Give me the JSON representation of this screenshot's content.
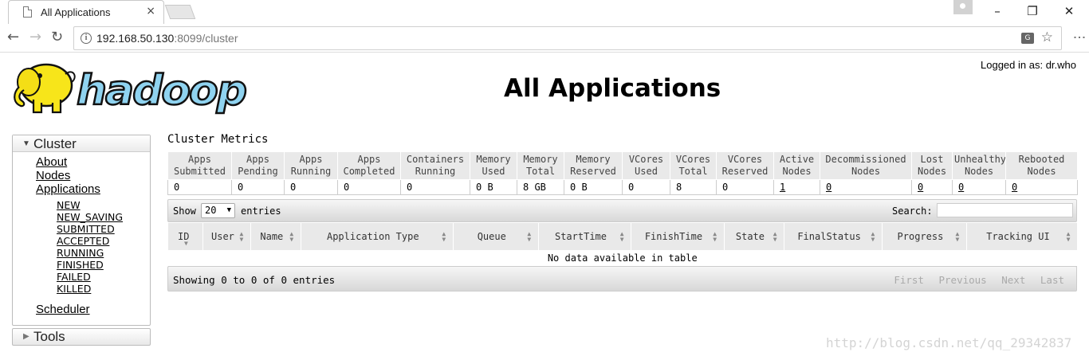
{
  "browser": {
    "tab_title": "All Applications",
    "tab_close": "×",
    "window_controls": {
      "minimize": "–",
      "maximize": "❐",
      "close": "✕"
    },
    "nav": {
      "back": "←",
      "forward": "→",
      "reload": "↻"
    },
    "url_host": "192.168.50.130",
    "url_rest": ":8099/cluster",
    "info_icon": "i",
    "translate_icon": "G",
    "bookmark_icon": "☆",
    "menu_icon": "⋮"
  },
  "header": {
    "logo_text": "hadoop",
    "logged_in": "Logged in as: dr.who",
    "title": "All Applications"
  },
  "sidebar": {
    "cluster_title": "Cluster",
    "links": [
      "About",
      "Nodes",
      "Applications"
    ],
    "app_states": [
      "NEW",
      "NEW_SAVING",
      "SUBMITTED",
      "ACCEPTED",
      "RUNNING",
      "FINISHED",
      "FAILED",
      "KILLED"
    ],
    "scheduler": "Scheduler",
    "tools_title": "Tools"
  },
  "metrics": {
    "title": "Cluster Metrics",
    "headers": [
      [
        "Apps",
        "Submitted"
      ],
      [
        "Apps",
        "Pending"
      ],
      [
        "Apps",
        "Running"
      ],
      [
        "Apps",
        "Completed"
      ],
      [
        "Containers",
        "Running"
      ],
      [
        "Memory",
        "Used"
      ],
      [
        "Memory",
        "Total"
      ],
      [
        "Memory",
        "Reserved"
      ],
      [
        "VCores",
        "Used"
      ],
      [
        "VCores",
        "Total"
      ],
      [
        "VCores",
        "Reserved"
      ],
      [
        "Active",
        "Nodes"
      ],
      [
        "Decommissioned",
        "Nodes"
      ],
      [
        "Lost",
        "Nodes"
      ],
      [
        "Unhealthy",
        "Nodes"
      ],
      [
        "Rebooted",
        "Nodes"
      ]
    ],
    "values": [
      "0",
      "0",
      "0",
      "0",
      "0",
      "0 B",
      "8 GB",
      "0 B",
      "0",
      "8",
      "0",
      "1",
      "0",
      "0",
      "0",
      "0"
    ]
  },
  "apps_table": {
    "show_label": "Show",
    "page_size": "20",
    "entries_label": "entries",
    "search_label": "Search:",
    "columns": [
      "ID",
      "User",
      "Name",
      "Application Type",
      "Queue",
      "StartTime",
      "FinishTime",
      "State",
      "FinalStatus",
      "Progress",
      "Tracking UI"
    ],
    "empty_message": "No data available in table",
    "info": "Showing 0 to 0 of 0 entries",
    "pager": [
      "First",
      "Previous",
      "Next",
      "Last"
    ]
  },
  "watermark": "http://blog.csdn.net/qq_29342837"
}
